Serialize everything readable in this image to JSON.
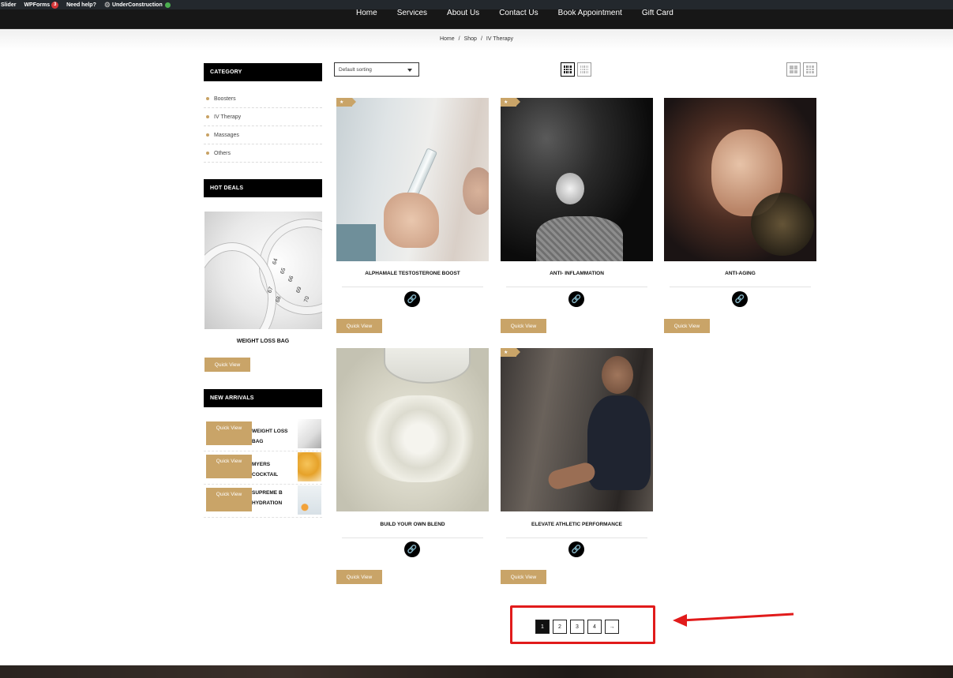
{
  "admin_bar": {
    "items": [
      "Slider",
      "WPForms",
      "Need help?",
      "UnderConstruction"
    ],
    "wpforms_count": "3"
  },
  "nav": {
    "items": [
      "Home",
      "Services",
      "About Us",
      "Contact Us",
      "Book Appointment",
      "Gift Card"
    ]
  },
  "breadcrumb": {
    "home": "Home",
    "shop": "Shop",
    "current": "IV Therapy",
    "sep": "/"
  },
  "sidebar": {
    "category_title": "Category",
    "categories": [
      "Boosters",
      "IV Therapy",
      "Massages",
      "Others"
    ],
    "hot_deals_title": "Hot Deals",
    "hot_deal": {
      "name": "WEIGHT LOSS BAG",
      "quick_view": "Quick View",
      "tape_numbers": [
        "64",
        "65",
        "66",
        "67",
        "68",
        "69",
        "70"
      ]
    },
    "new_arrivals_title": "New Arrivals",
    "new_arrivals": [
      {
        "name": "WEIGHT LOSS BAG",
        "quick_view": "Quick View"
      },
      {
        "name": "MYERS COCKTAIL",
        "quick_view": "Quick View"
      },
      {
        "name": "SUPREME B HYDRATION",
        "quick_view": "Quick View"
      }
    ]
  },
  "toolbar": {
    "sorting": "Default sorting"
  },
  "products": [
    {
      "name": "ALPHAMALE TESTOSTERONE BOOST",
      "quick_view": "Quick View",
      "featured": true
    },
    {
      "name": "ANTI- INFLAMMATION",
      "quick_view": "Quick View",
      "featured": true
    },
    {
      "name": "ANTI-AGING",
      "quick_view": "Quick View",
      "featured": false
    },
    {
      "name": "BUILD YOUR OWN BLEND",
      "quick_view": "Quick View",
      "featured": false
    },
    {
      "name": "ELEVATE ATHLETIC PERFORMANCE",
      "quick_view": "Quick View",
      "featured": true
    }
  ],
  "pagination": {
    "pages": [
      "1",
      "2",
      "3",
      "4"
    ],
    "current": "1",
    "next": "→"
  },
  "colors": {
    "accent": "#c9a468",
    "nav_bg": "#171717",
    "highlight": "#e11b1b"
  }
}
